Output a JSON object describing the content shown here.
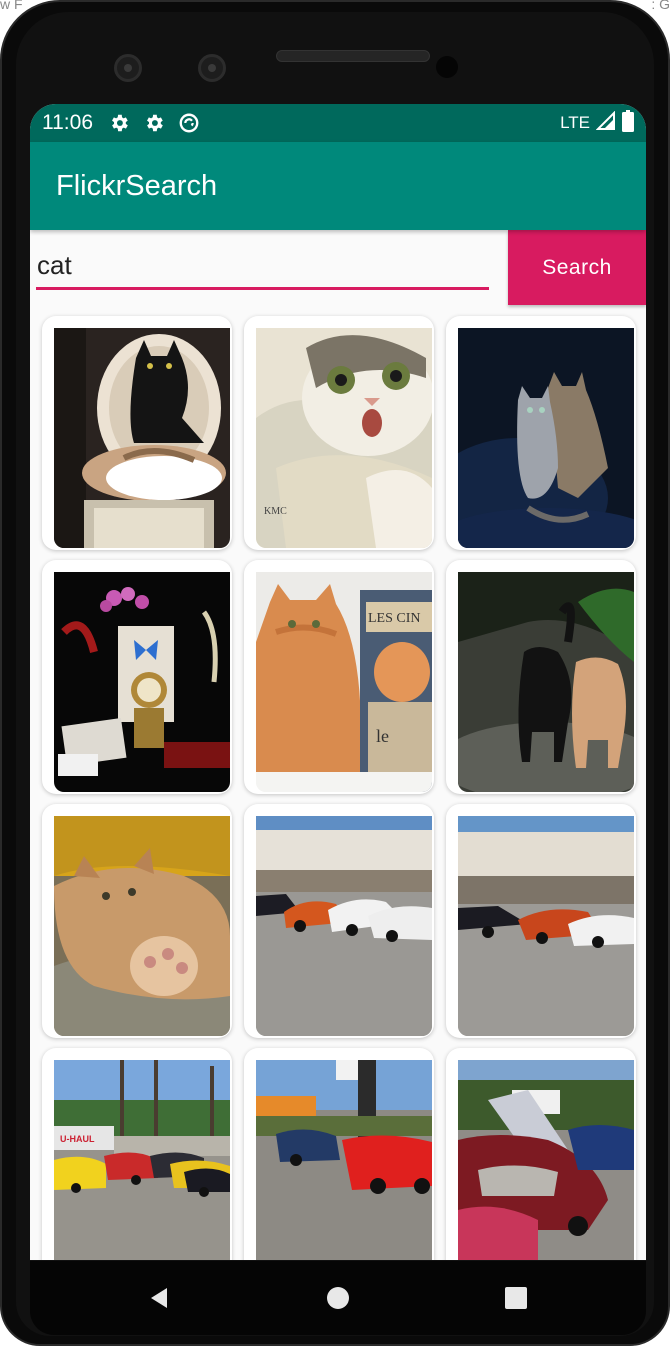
{
  "device_top": {
    "left_text": "w F",
    "right_text": ": G"
  },
  "status_bar": {
    "time": "11:06",
    "icons": [
      "settings-icon",
      "settings-icon",
      "sync-icon"
    ],
    "network": "LTE",
    "signal_icon": "signal-icon",
    "battery_icon": "battery-icon",
    "background_color": "#00695c"
  },
  "app_bar": {
    "title": "FlickrSearch",
    "background_color": "#00897b"
  },
  "search": {
    "query": "cat",
    "button_label": "Search",
    "accent_color": "#d81b60"
  },
  "results": [
    {
      "subject": "illustrated black cat on chair with sleeping white cat"
    },
    {
      "subject": "watercolor surprised cat"
    },
    {
      "subject": "two cats on dark blue background"
    },
    {
      "subject": "still life with clock, butterfly and orchids"
    },
    {
      "subject": "orange cat beside Les Cinemas tin"
    },
    {
      "subject": "black cat and orange cat walking"
    },
    {
      "subject": "orange tabby cat lying on ground"
    },
    {
      "subject": "parked sports cars in lot"
    },
    {
      "subject": "parked sports cars in lot"
    },
    {
      "subject": "yellow and red sports cars near U-Haul"
    },
    {
      "subject": "red and blue sports cars parked"
    },
    {
      "subject": "red sports car with open hood"
    }
  ],
  "nav_bar": {
    "back": "back-icon",
    "home": "home-icon",
    "recents": "recents-icon"
  }
}
